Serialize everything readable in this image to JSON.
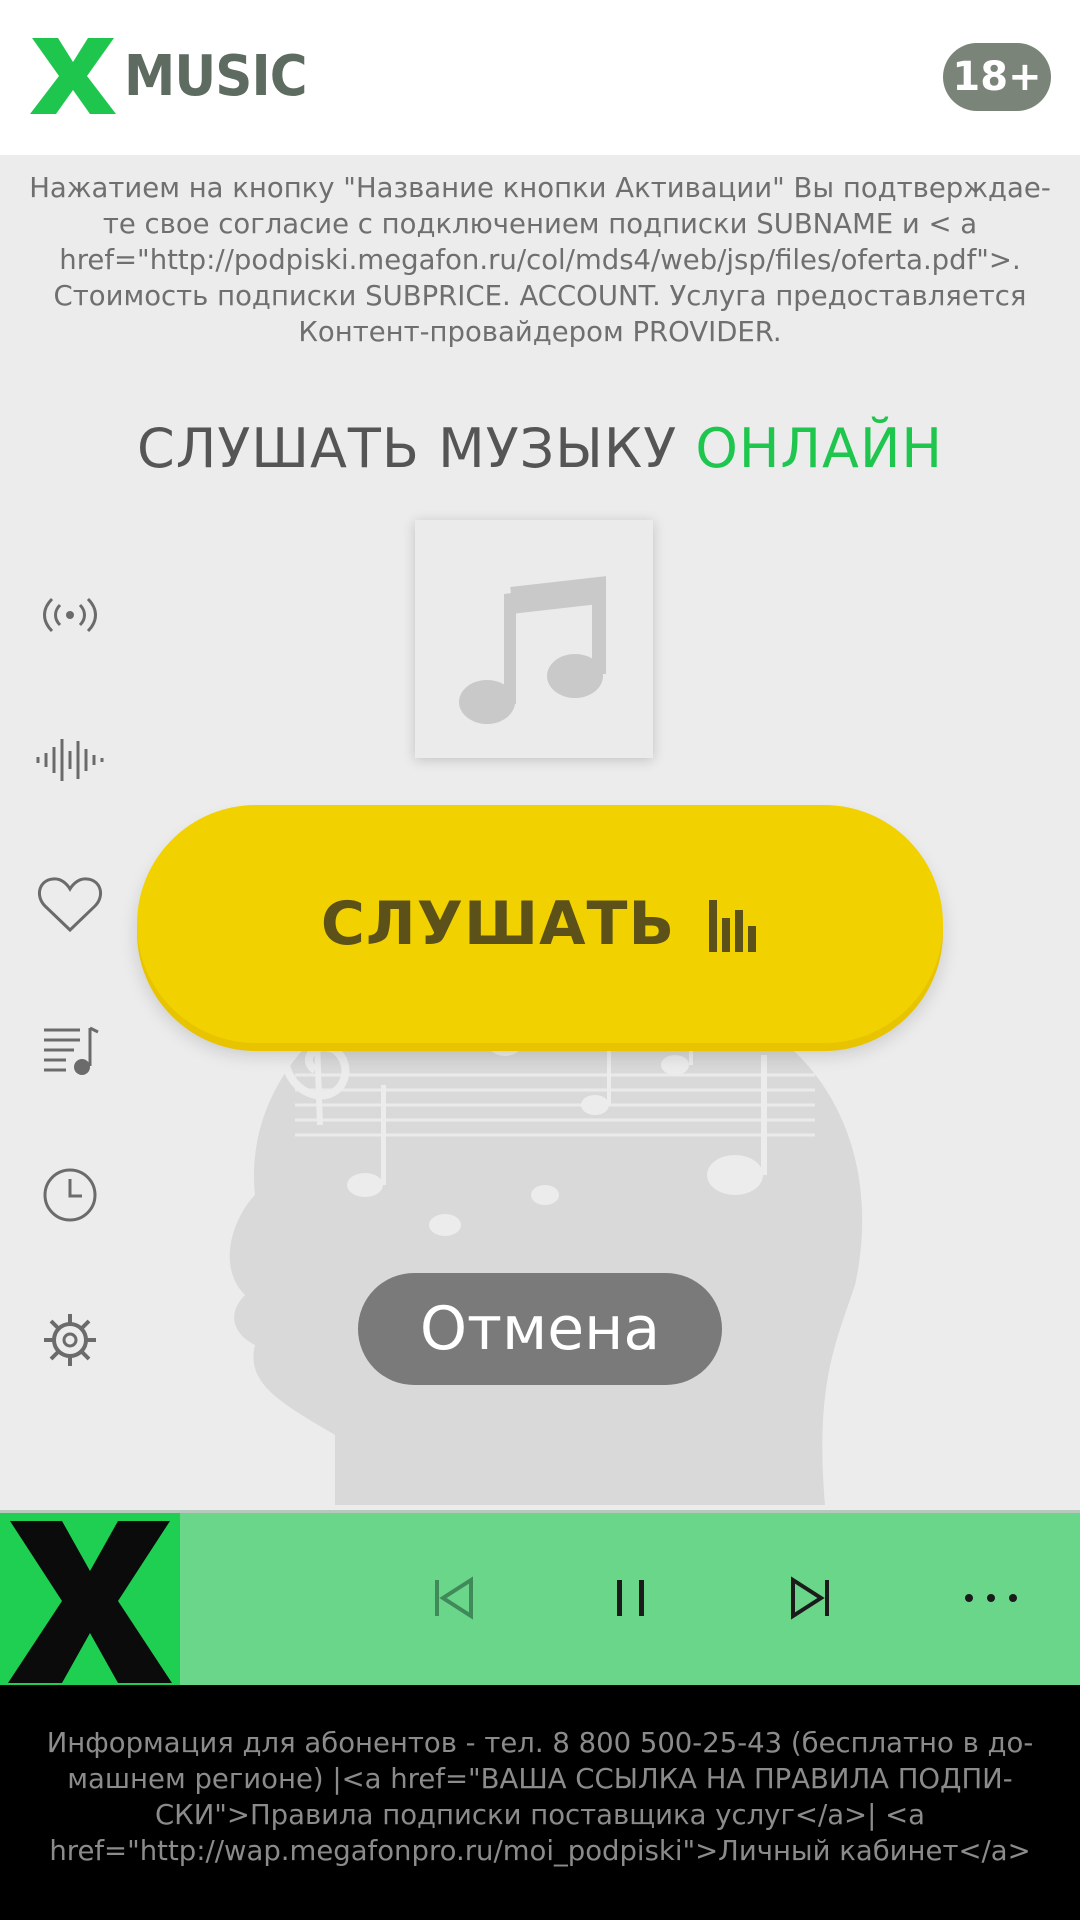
{
  "header": {
    "logo_letter": "X",
    "logo_text": "MUSIC",
    "age_badge": "18+",
    "colors": {
      "logo_green": "#1ec64e",
      "logo_text": "#5e6b60",
      "badge_bg": "#7b8478"
    }
  },
  "offer_text": "Нажатием на кнопку \"Название кнопки Активации\" Вы подтверждае-те свое согласие с подключением подписки SUBNAME и < a href=\"http://podpiski.megafon.ru/col/mds4/web/jsp/files/oferta.pdf\">. Стоимость подписки SUBPRICE. ACCOUNT. Услуга предоставляется Контент-провайдером PROVIDER.",
  "heading": {
    "main": "СЛУШАТЬ МУЗЫКУ",
    "accent": "ОНЛАЙН",
    "accent_color": "#1ec64e"
  },
  "side_menu": {
    "items": [
      {
        "icon": "broadcast-icon"
      },
      {
        "icon": "waveform-icon"
      },
      {
        "icon": "heart-icon"
      },
      {
        "icon": "playlist-icon"
      },
      {
        "icon": "clock-icon"
      },
      {
        "icon": "gear-icon"
      }
    ]
  },
  "listen_button": {
    "label": "СЛУШАТЬ",
    "icon": "equalizer-icon",
    "color": "#f2d100"
  },
  "cancel_button": {
    "label": "Отмена"
  },
  "player": {
    "background": "#6ad68a",
    "controls": [
      "previous-icon",
      "pause-icon",
      "next-icon",
      "more-icon"
    ]
  },
  "footer": {
    "text": "Информация для абонентов - тел. 8 800 500-25-43 (бесплатно в до-машнем регионе) |<a href=\"ВАША ССЫЛКА НА ПРАВИЛА ПОДПИ-СКИ\">Правила подписки поставщика услуг</a>| <a href=\"http://wap.megafonpro.ru/moi_podpiski\">Личный кабинет</a>"
  }
}
